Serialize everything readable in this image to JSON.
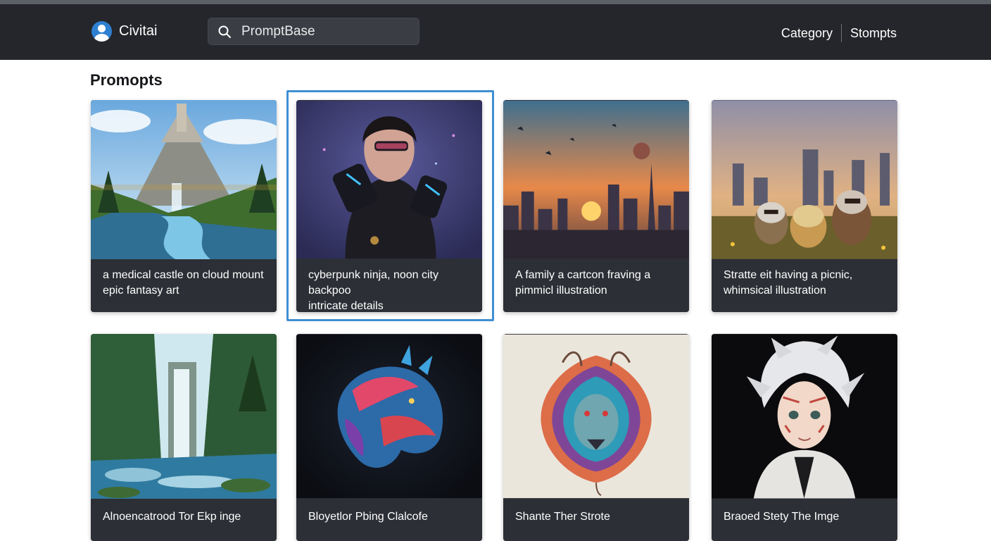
{
  "header": {
    "brand": "Civitai",
    "search_value": "PromptBase",
    "nav": [
      "Category",
      "Stompts"
    ]
  },
  "section": {
    "title": "Promopts"
  },
  "cards": [
    {
      "caption": "a medical castle on cloud mount\nepic fantasy art",
      "image": "fantasy-castle-waterfall"
    },
    {
      "caption": "cyberpunk ninja, noon city backpoo\nintricate details",
      "image": "cyberpunk-ninja-portrait"
    },
    {
      "caption": "A family a cartcon fraving a\npimmicl illustration",
      "image": "sunset-city-skyline"
    },
    {
      "caption": "Stratte eit having a picnic,\nwhimsical illustration",
      "image": "raccoons-picnic-city"
    },
    {
      "caption": "Alnoencatrood Tor Ekp inge",
      "image": "forest-waterfall"
    },
    {
      "caption": "Bloyetlor Pbing Clalcofe",
      "image": "neon-dragon-head"
    },
    {
      "caption": "Shante Ther Strote",
      "image": "colorful-wolf-head"
    },
    {
      "caption": "Braoed Stety The Imge",
      "image": "anime-white-hair-character"
    }
  ],
  "selected_index": 1,
  "colors": {
    "header": "#24262b",
    "accent": "#3f8fd2",
    "caption_bg": "#2c2f35"
  }
}
